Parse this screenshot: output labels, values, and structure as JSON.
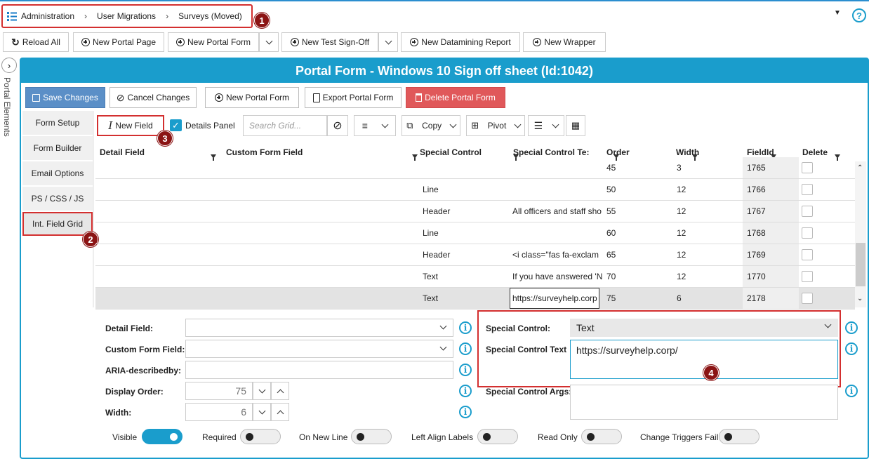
{
  "breadcrumb": {
    "items": [
      "Administration",
      "User Migrations",
      "Surveys (Moved)"
    ]
  },
  "callouts": [
    "1",
    "2",
    "3",
    "4"
  ],
  "help": "?",
  "toolbar": {
    "reload": "Reload All",
    "new_portal_page": "New Portal Page",
    "new_portal_form": "New Portal Form",
    "new_test_signoff": "New Test Sign-Off",
    "new_datamining": "New Datamining Report",
    "new_wrapper": "New Wrapper"
  },
  "side_tab": "Portal Elements",
  "form": {
    "title": "Portal Form -  Windows 10 Sign off sheet  (Id:1042)",
    "actions": {
      "save": "Save Changes",
      "cancel": "Cancel Changes",
      "new_form": "New Portal Form",
      "export": "Export Portal Form",
      "delete": "Delete Portal Form"
    }
  },
  "left_nav": [
    "Form Setup",
    "Form Builder",
    "Email Options",
    "PS / CSS / JS",
    "Int. Field Grid"
  ],
  "grid_toolbar": {
    "new_field": "New Field",
    "details_panel": "Details Panel",
    "search_placeholder": "Search Grid...",
    "copy": "Copy",
    "pivot": "Pivot"
  },
  "grid": {
    "columns": [
      "Detail Field",
      "Custom Form Field",
      "Special Control",
      "Special Control Te:",
      "Order",
      "Width",
      "FieldId",
      "Delete"
    ],
    "rows": [
      {
        "special": "",
        "text": "",
        "order": "45",
        "width": "3",
        "fieldid": "1765"
      },
      {
        "special": "Line",
        "text": "",
        "order": "50",
        "width": "12",
        "fieldid": "1766"
      },
      {
        "special": "Header",
        "text": "All officers and staff sho",
        "order": "55",
        "width": "12",
        "fieldid": "1767"
      },
      {
        "special": "Line",
        "text": "",
        "order": "60",
        "width": "12",
        "fieldid": "1768"
      },
      {
        "special": "Header",
        "text": "<i class=\"fas fa-exclam",
        "order": "65",
        "width": "12",
        "fieldid": "1769"
      },
      {
        "special": "Text",
        "text": "If you have answered 'N",
        "order": "70",
        "width": "12",
        "fieldid": "1770"
      },
      {
        "special": "Text",
        "text": "https://surveyhelp.corp",
        "order": "75",
        "width": "6",
        "fieldid": "2178"
      }
    ]
  },
  "details": {
    "detail_field_label": "Detail Field:",
    "custom_form_field_label": "Custom Form Field:",
    "aria_label": "ARIA-describedby:",
    "display_order_label": "Display Order:",
    "display_order": "75",
    "width_label": "Width:",
    "width": "6",
    "special_control_label": "Special Control:",
    "special_control": "Text",
    "special_control_text_label": "Special Control Text",
    "special_control_text": "https://surveyhelp.corp/",
    "special_control_args_label": "Special Control Args:"
  },
  "toggles": [
    {
      "label": "Visible",
      "on": true
    },
    {
      "label": "Required",
      "on": false
    },
    {
      "label": "On New Line",
      "on": false
    },
    {
      "label": "Left Align Labels",
      "on": false
    },
    {
      "label": "Read Only",
      "on": false
    },
    {
      "label": "Change Triggers Fail",
      "on": false
    }
  ],
  "colors": {
    "accent": "#1a9dcc",
    "highlight": "#d32f2f",
    "callout": "#8b1414",
    "delete": "#e0585a"
  }
}
